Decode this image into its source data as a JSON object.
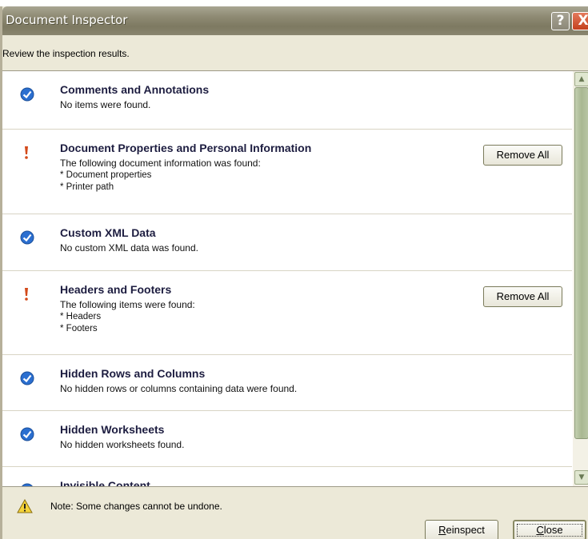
{
  "window": {
    "title": "Document Inspector",
    "help_glyph": "?",
    "close_glyph": "X"
  },
  "subtitle": "Review the inspection results.",
  "items": [
    {
      "status": "check",
      "heading": "Comments and Annotations",
      "desc": "No items were found."
    },
    {
      "status": "warning",
      "heading": "Document Properties and Personal Information",
      "desc": "The following document information was found:",
      "details": [
        "* Document properties",
        "* Printer path"
      ],
      "button": "Remove All"
    },
    {
      "status": "check",
      "heading": "Custom XML Data",
      "desc": "No custom XML data was found."
    },
    {
      "status": "warning",
      "heading": "Headers and Footers",
      "desc": "The following items were found:",
      "details": [
        "* Headers",
        "* Footers"
      ],
      "button": "Remove All"
    },
    {
      "status": "check",
      "heading": "Hidden Rows and Columns",
      "desc": "No hidden rows or columns containing data were found."
    },
    {
      "status": "check",
      "heading": "Hidden Worksheets",
      "desc": "No hidden worksheets found."
    },
    {
      "status": "check",
      "heading": "Invisible Content"
    }
  ],
  "note": "Note: Some changes cannot be undone.",
  "buttons": {
    "reinspect_first": "R",
    "reinspect_rest": "einspect",
    "close_first": "C",
    "close_rest": "lose"
  },
  "colors": {
    "check": "#2b6fd0",
    "warning": "#d34a1a",
    "accent": "#8f8b74"
  }
}
